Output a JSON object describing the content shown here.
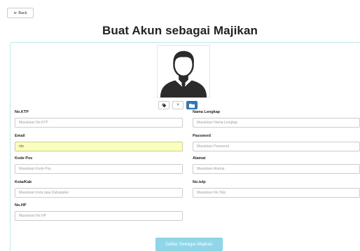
{
  "nav": {
    "back_label": "Back"
  },
  "page": {
    "title": "Buat Akun sebagai Majikan"
  },
  "form": {
    "no_ktp": {
      "label": "No.KTP",
      "placeholder": "Masukkan No.KTP",
      "value": ""
    },
    "nama_lengkap": {
      "label": "Nama Lengkap",
      "placeholder": "Masukkan Nama Lengkap",
      "value": ""
    },
    "email": {
      "label": "Email",
      "placeholder": "",
      "value": "rds"
    },
    "password": {
      "label": "Password",
      "placeholder": "Masukkan Password",
      "value": ""
    },
    "kode_pos": {
      "label": "Kode Pos",
      "placeholder": "Masukkan Kode Pos",
      "value": ""
    },
    "alamat": {
      "label": "Alamat",
      "placeholder": "Masukkan Alamat",
      "value": ""
    },
    "kota_kab": {
      "label": "Kota/Kab",
      "placeholder": "Masukkan Kota atau Kabupaten",
      "value": ""
    },
    "no_telp": {
      "label": "No.telp",
      "placeholder": "Masukkan No.Telp",
      "value": ""
    },
    "no_hp": {
      "label": "No.HP",
      "placeholder": "Masukkan No.HP",
      "value": ""
    }
  },
  "avatar_tools": {
    "tag_icon": "tag-icon",
    "remove_icon": "close-icon",
    "upload_icon": "folder-icon",
    "remove_glyph": "×"
  },
  "submit": {
    "label": "Daftar Sebagai Majikan"
  },
  "colors": {
    "primary": "#337ab7",
    "submit": "#8fd6e8",
    "autofill": "#faffbd",
    "panel_border": "#bfe6ec"
  }
}
